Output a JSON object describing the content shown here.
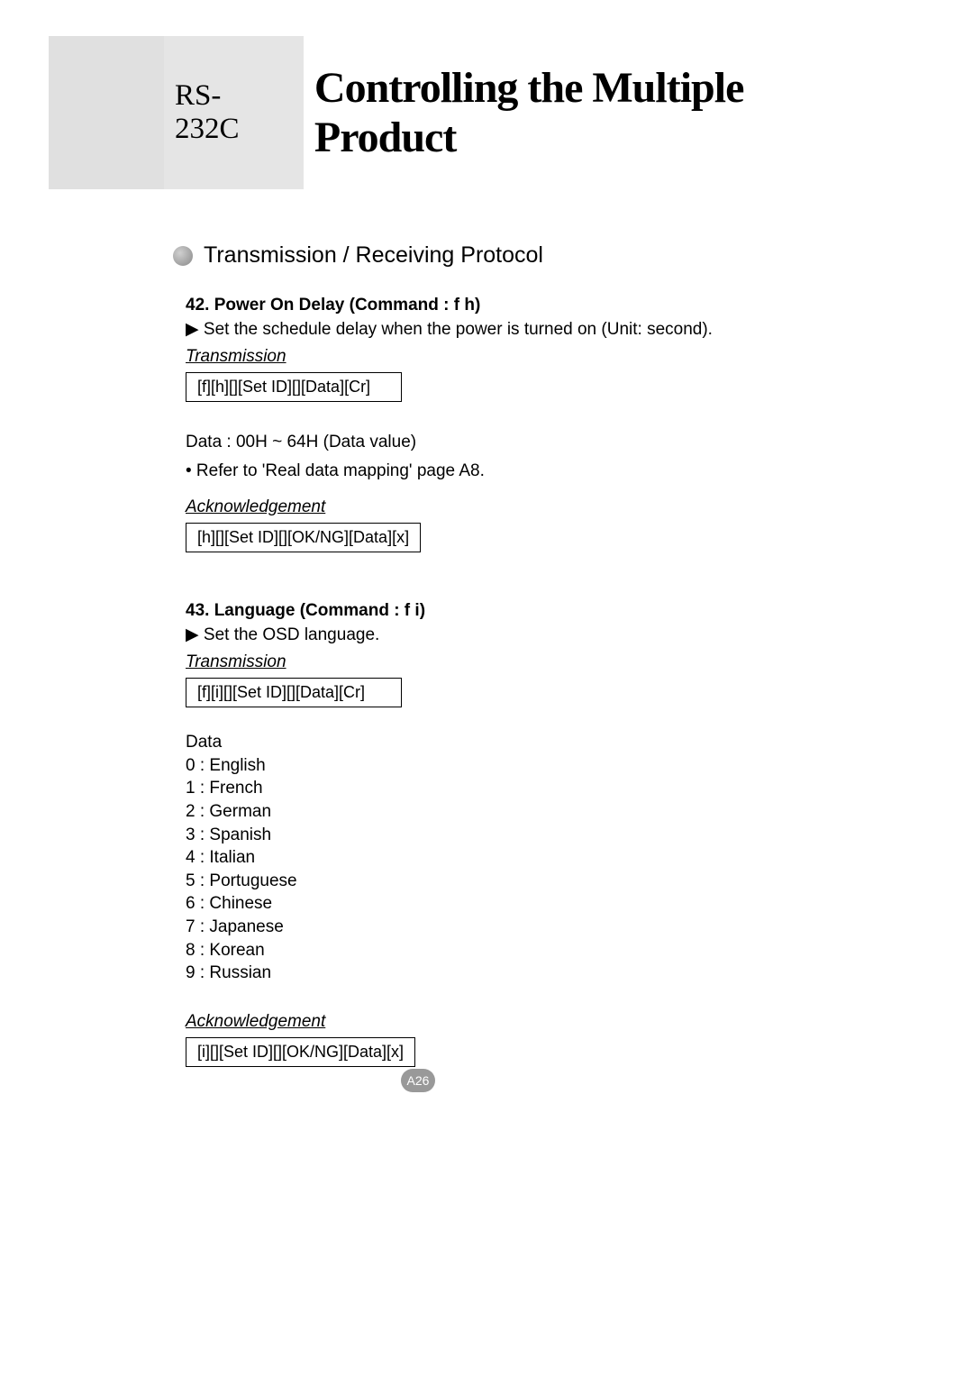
{
  "header": {
    "prefix": "RS-232C",
    "title": "Controlling the Multiple Product"
  },
  "section": {
    "heading": "Transmission / Receiving Protocol"
  },
  "command42": {
    "title": "42. Power On Delay (Command : f h)",
    "desc": "▶ Set the schedule delay when the power is turned on (Unit: second).",
    "transmission_label": "Transmission",
    "transmission_code": "[f][h][][Set ID][][Data][Cr]",
    "data_note": "Data : 00H ~ 64H (Data value)",
    "ref_note": "• Refer to 'Real data mapping' page A8.",
    "ack_label": "Acknowledgement",
    "ack_code": "[h][][Set ID][][OK/NG][Data][x]"
  },
  "command43": {
    "title": "43. Language (Command : f i)",
    "desc": "▶ Set the OSD language.",
    "transmission_label": "Transmission",
    "transmission_code": "[f][i][][Set ID][][Data][Cr]",
    "data_header": "Data",
    "languages": [
      "0 : English",
      "1 : French",
      "2 : German",
      "3 : Spanish",
      "4 : Italian",
      "5 : Portuguese",
      "6 : Chinese",
      "7 : Japanese",
      "8 : Korean",
      "9 : Russian"
    ],
    "ack_label": "Acknowledgement",
    "ack_code": "[i][][Set ID][][OK/NG][Data][x]"
  },
  "page_number": "A26"
}
